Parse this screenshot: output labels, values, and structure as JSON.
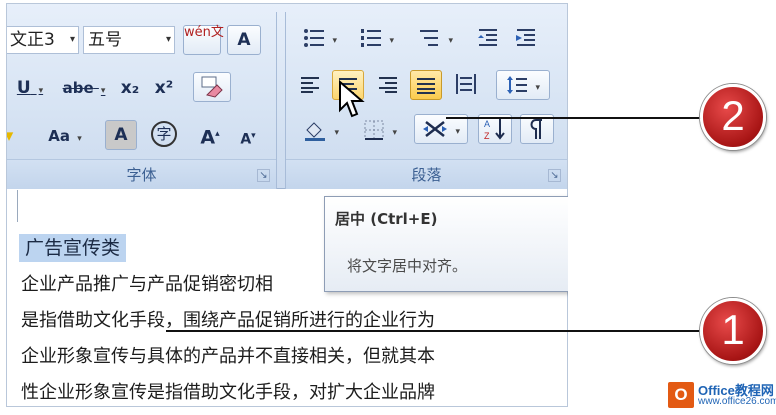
{
  "font_group": {
    "font_name": "文正3",
    "font_size": "五号",
    "wen_button": "wén文",
    "border_a": "A",
    "underline": "U",
    "strike": "abe",
    "subscript": "x₂",
    "superscript": "x²",
    "change_case": "Aa",
    "char_shading": "A",
    "enclose": "字",
    "grow": "A",
    "shrink": "A",
    "label": "字体"
  },
  "paragraph_group": {
    "label": "段落"
  },
  "document": {
    "heading": "广告宣传类",
    "lines": [
      "企业产品推广与产品促销密切相",
      "是指借助文化手段，围绕产品促销所进行的企业行为",
      "企业形象宣传与具体的产品并不直接相关，但就其本",
      "性企业形象宣传是指借助文化手段，对扩大企业品牌"
    ]
  },
  "tooltip": {
    "title": "居中 (Ctrl+E)",
    "description": "将文字居中对齐。"
  },
  "callouts": {
    "one": "1",
    "two": "2"
  },
  "watermark": {
    "logo": "O",
    "name": "Office教程网",
    "url": "www.office26.com"
  }
}
